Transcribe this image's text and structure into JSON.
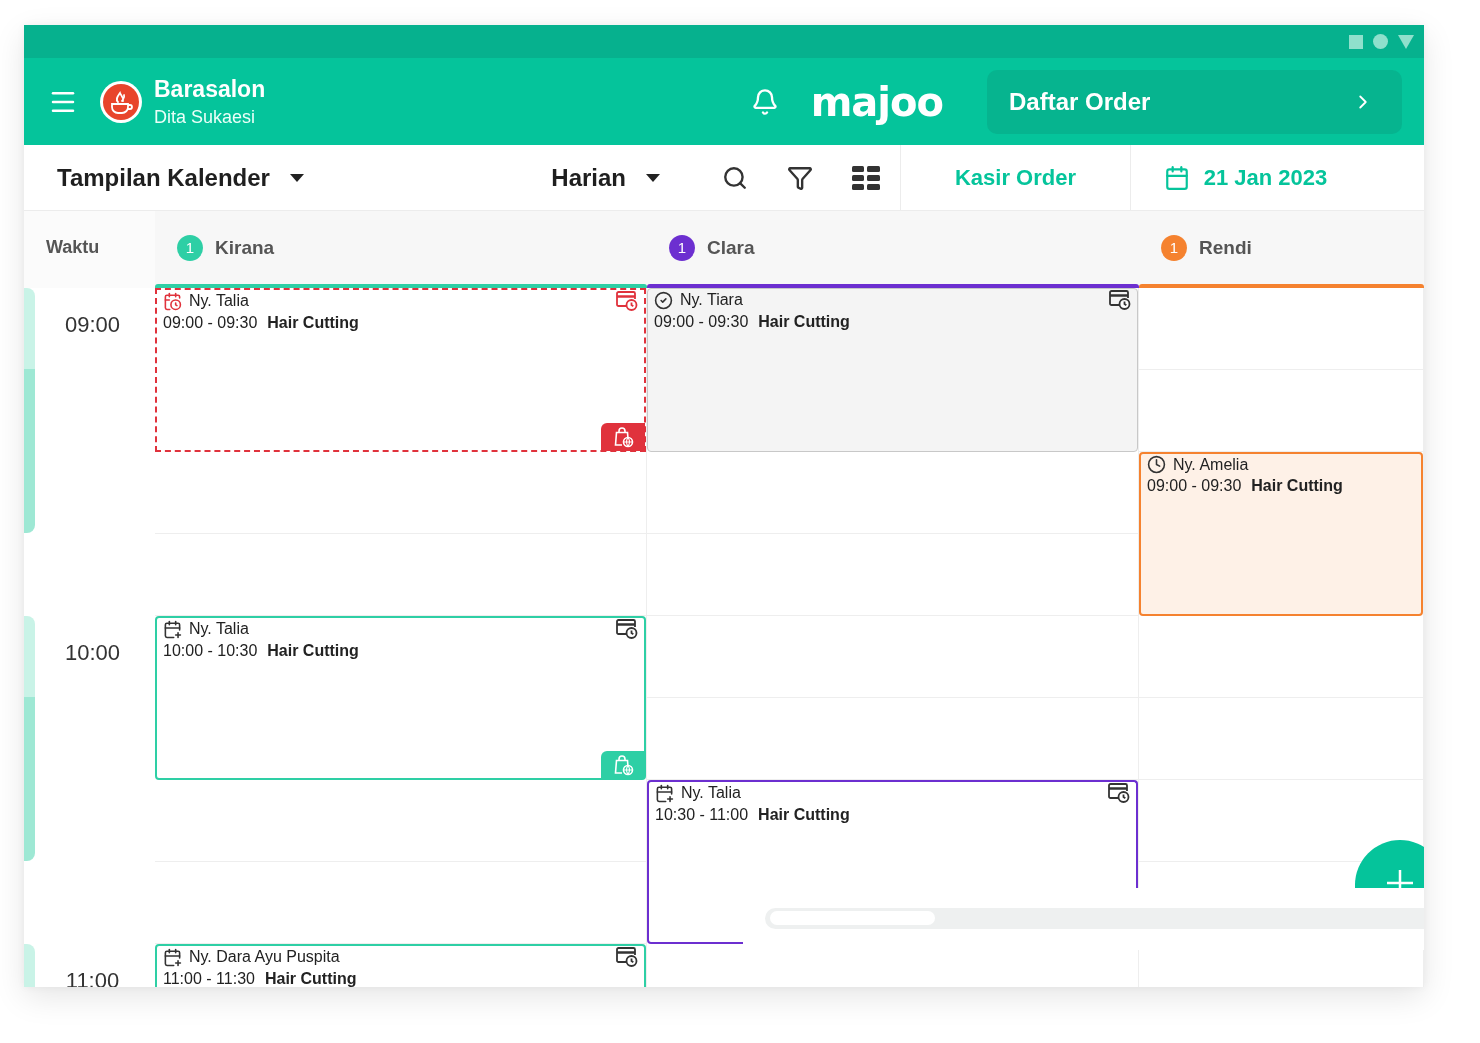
{
  "header": {
    "store": "Barasalon",
    "user": "Dita Sukaesi",
    "brand": "majoo",
    "order_button": "Daftar Order"
  },
  "toolbar": {
    "view": "Tampilan Kalender",
    "period": "Harian",
    "cashier_button": "Kasir Order",
    "date": "21 Jan 2023"
  },
  "time_column": {
    "label": "Waktu",
    "hours": [
      "09:00",
      "10:00",
      "11:00"
    ]
  },
  "staff": [
    {
      "name": "Kirana",
      "count": "1",
      "color": "#2ecfa5",
      "slots": [
        {
          "kind": "overdue",
          "customer": "Ny. Talia",
          "time": "09:00 - 09:30",
          "service": "Hair Cutting",
          "payment_icon": true,
          "online": true
        },
        {
          "kind": "empty"
        },
        {
          "kind": "booked",
          "customer": "Ny. Talia",
          "time": "10:00 - 10:30",
          "service": "Hair Cutting",
          "payment_icon": true,
          "online": true
        },
        {
          "kind": "empty"
        },
        {
          "kind": "booked",
          "customer": "Ny. Dara Ayu Puspita",
          "time": "11:00 - 11:30",
          "service": "Hair Cutting",
          "payment_icon": true,
          "online": false
        }
      ]
    },
    {
      "name": "Clara",
      "count": "1",
      "color": "#6c2fd0",
      "slots": [
        {
          "kind": "done",
          "customer": "Ny. Tiara",
          "time": "09:00 - 09:30",
          "service": "Hair Cutting",
          "payment_icon": true,
          "online": false
        },
        {
          "kind": "empty"
        },
        {
          "kind": "empty"
        },
        {
          "kind": "booked",
          "customer": "Ny. Talia",
          "time": "10:30 - 11:00",
          "service": "Hair Cutting",
          "payment_icon": true,
          "online": false
        },
        {
          "kind": "empty"
        }
      ]
    },
    {
      "name": "Rendi",
      "count": "1",
      "color": "#f5822f",
      "slots": [
        {
          "kind": "empty"
        },
        {
          "kind": "waiting",
          "customer": "Ny. Amelia",
          "time": "09:00 - 09:30",
          "service": "Hair Cutting",
          "payment_icon": false,
          "online": false
        },
        {
          "kind": "empty"
        },
        {
          "kind": "empty"
        },
        {
          "kind": "empty"
        }
      ]
    }
  ]
}
